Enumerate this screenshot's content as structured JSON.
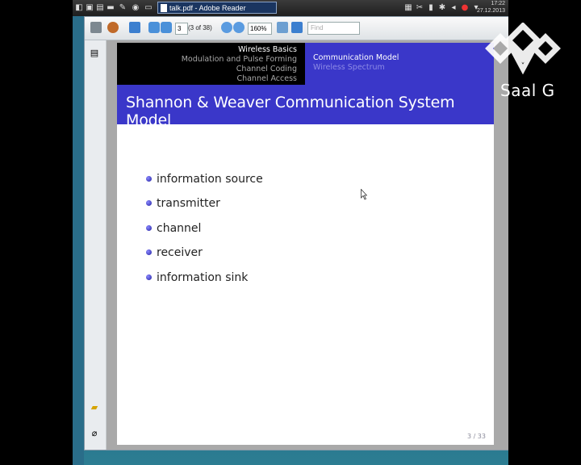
{
  "taskbar": {
    "task_label": "talk.pdf - Adobe Reader",
    "clock_time": "17:22",
    "clock_date": "27.12.2013"
  },
  "toolbar": {
    "page_current": "3",
    "page_of": "(3 of 38)",
    "zoom": "160%",
    "find_placeholder": "Find"
  },
  "slide": {
    "sections_left": [
      "Wireless Basics",
      "Modulation and Pulse Forming",
      "Channel Coding",
      "Channel Access"
    ],
    "sections_right": [
      "Communication Model",
      "Wireless Spectrum"
    ],
    "title": "Shannon & Weaver Communication System Model",
    "bullets": [
      "information source",
      "transmitter",
      "channel",
      "receiver",
      "information sink"
    ],
    "page_number": "3 / 33"
  },
  "watermark": {
    "text": "Saal G"
  },
  "colors": {
    "beamer_blue": "#3a37c9",
    "header_black": "#000000"
  }
}
